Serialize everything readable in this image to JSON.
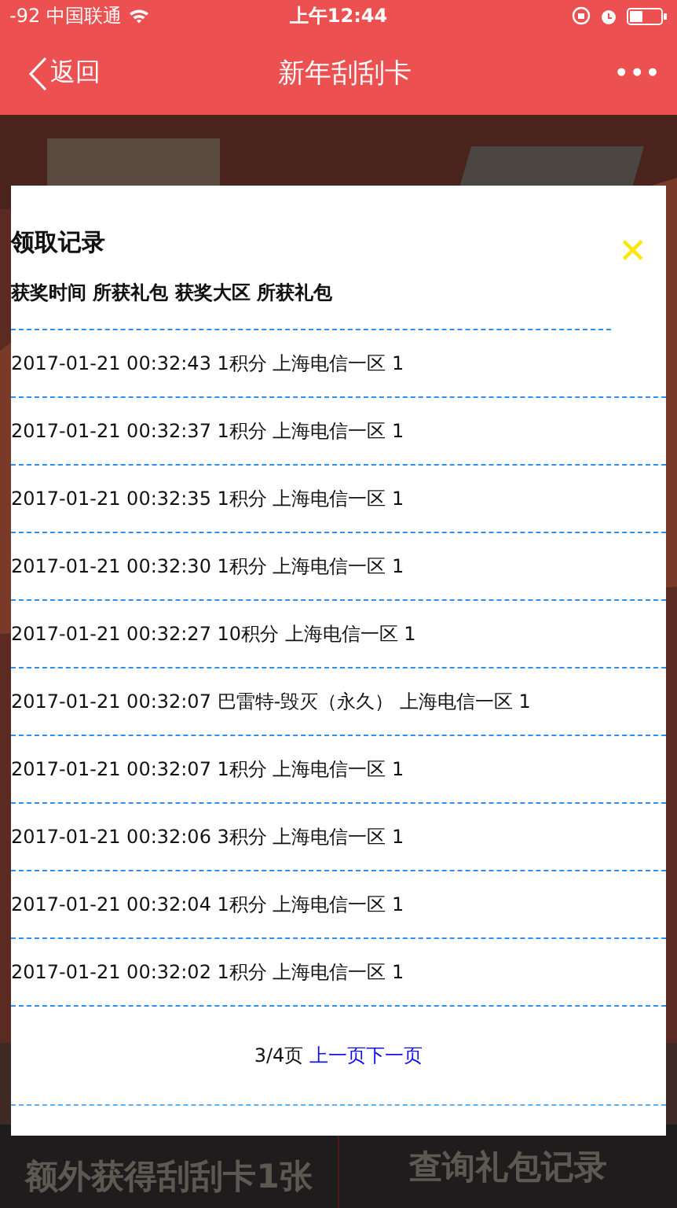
{
  "status_bar": {
    "carrier": "-92 中国联通",
    "time": "上午12:44"
  },
  "nav_bar": {
    "back": "返回",
    "title": "新年刮刮卡",
    "more": "•••"
  },
  "page": {
    "kind": "picture",
    "footer": [
      {
        "text": "额外获得刮刮卡1张"
      },
      {
        "text": "查询礼包记录"
      }
    ]
  },
  "dialog": {
    "title": "领取记录",
    "close": "✕",
    "header": "获奖时间 所获礼包 获奖大区 所获礼包",
    "rows": [
      "2017-01-21 00:32:43 1积分 上海电信一区 1",
      "2017-01-21 00:32:37 1积分 上海电信一区 1",
      "2017-01-21 00:32:35 1积分 上海电信一区 1",
      "2017-01-21 00:32:30 1积分 上海电信一区 1",
      "2017-01-21 00:32:27 10积分 上海电信一区 1",
      "2017-01-21 00:32:07 巴雷特-毁灭（永久） 上海电信一区 1",
      "2017-01-21 00:32:07 1积分 上海电信一区 1",
      "2017-01-21 00:32:06 3积分 上海电信一区 1",
      "2017-01-21 00:32:04 1积分 上海电信一区 1",
      "2017-01-21 00:32:02 1积分 上海电信一区 1"
    ],
    "pager": {
      "info": "3/4页",
      "links": [
        "上一页",
        "下一页"
      ]
    }
  }
}
